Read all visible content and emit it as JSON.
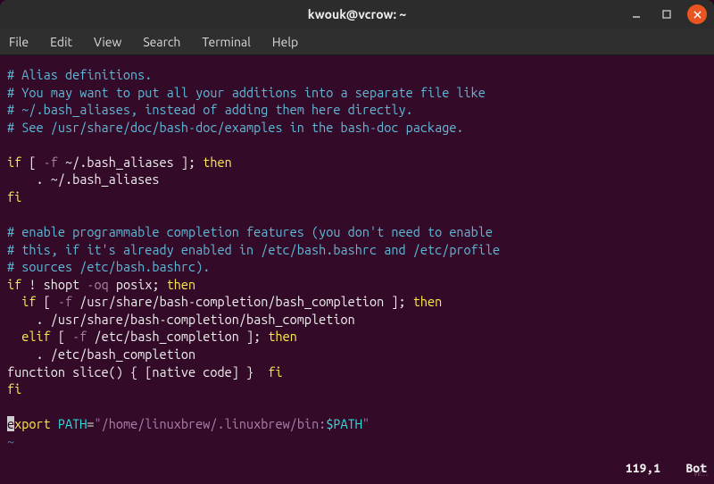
{
  "window": {
    "title": "kwouk@vcrow: ~"
  },
  "menubar": {
    "items": [
      "File",
      "Edit",
      "View",
      "Search",
      "Terminal",
      "Help"
    ]
  },
  "editor": {
    "lines": [
      {
        "t": "# Alias definitions.",
        "cls": "comment"
      },
      {
        "t": "# You may want to put all your additions into a separate file like",
        "cls": "comment"
      },
      {
        "t": "# ~/.bash_aliases, instead of adding them here directly.",
        "cls": "comment"
      },
      {
        "t": "# See /usr/share/doc/bash-doc/examples in the bash-doc package.",
        "cls": "comment"
      },
      {
        "t": "",
        "cls": "normal"
      }
    ],
    "if1": {
      "a": "if",
      "b": " [ ",
      "c": "-f",
      "d": " ~/.bash_aliases ]; ",
      "e": "then"
    },
    "if1_body": "    . ~/.bash_aliases",
    "fi": "fi",
    "blank": "",
    "c2a": "# enable programmable completion features (you don't need to enable",
    "c2b": "# this, if it's already enabled in /etc/bash.bashrc and /etc/profile",
    "c2c": "# sources /etc/bash.bashrc).",
    "if2": {
      "a": "if",
      "b": " ! shopt ",
      "c": "-oq",
      "d": " posix; ",
      "e": "then"
    },
    "if3": {
      "pre": "  ",
      "a": "if",
      "b": " [ ",
      "c": "-f",
      "d": " /usr/share/bash-completion/bash_completion ]; ",
      "e": "then"
    },
    "body3": "    . /usr/share/bash-completion/bash_completion",
    "elif": {
      "pre": "  ",
      "a": "elif",
      "b": " [ ",
      "c": "-f",
      "d": " /etc/bash_completion ]; ",
      "e": "then"
    },
    "body4": "    . /etc/bash_completion",
    "fi2": "  fi",
    "fi3": "fi",
    "export": {
      "cursor": "e",
      "a": "xport ",
      "b": "PATH",
      "c": "=",
      "d": "\"/home/linuxbrew/.linuxbrew/bin:",
      "e": "$PATH",
      "f": "\""
    },
    "tilde": "~",
    "status_pos": "119,1",
    "status_loc": "Bot"
  },
  "watermark": "w..."
}
